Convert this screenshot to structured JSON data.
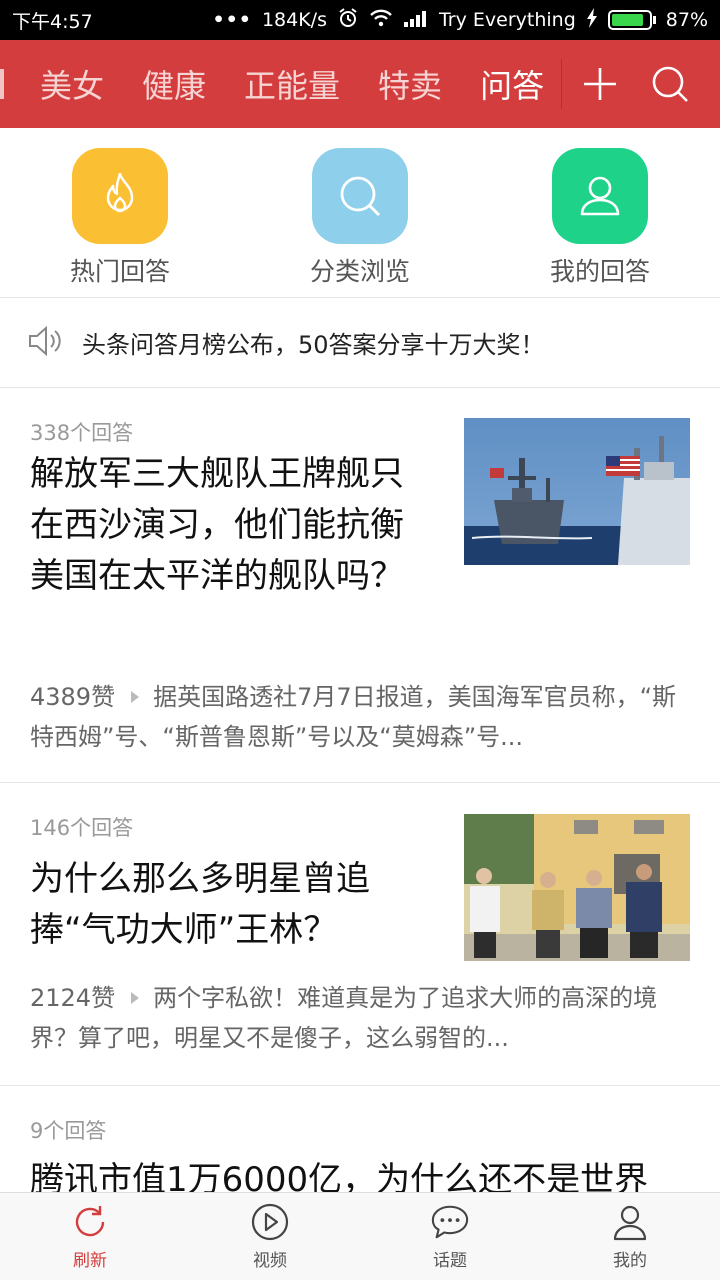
{
  "status_bar": {
    "time": "下午4:57",
    "dots": "•••",
    "speed": "184K/s",
    "carrier": "Try Everything",
    "battery": "87%",
    "battery_level": 0.87
  },
  "channels": [
    "美女",
    "健康",
    "正能量",
    "特卖",
    "问答"
  ],
  "active_channel": 4,
  "categories": [
    {
      "label": "热门回答",
      "color": "#fbbf33",
      "icon": "fire-icon"
    },
    {
      "label": "分类浏览",
      "color": "#8ed0ec",
      "icon": "search-icon"
    },
    {
      "label": "我的回答",
      "color": "#1fd28a",
      "icon": "user-icon"
    }
  ],
  "notice": "头条问答月榜公布，50答案分享十万大奖！",
  "feed": [
    {
      "count": "338个回答",
      "title": "解放军三大舰队王牌舰只在西沙演习，他们能抗衡美国在太平洋的舰队吗？",
      "likes": "4389赞",
      "excerpt": "据英国路透社7月7日报道，美国海军官员称，“斯特西姆”号、“斯普鲁恩斯”号以及“莫姆森”号..."
    },
    {
      "count": "146个回答",
      "title": "为什么那么多明星曾追捧“气功大师”王林？",
      "likes": "2124赞",
      "excerpt": "两个字私欲！难道真是为了追求大师的高深的境界？算了吧，明星又不是傻子，这么弱智的..."
    },
    {
      "count": "9个回答",
      "title": "腾讯市值1万6000亿，为什么还不是世界"
    }
  ],
  "tabs": [
    {
      "label": "刷新",
      "icon": "refresh-icon"
    },
    {
      "label": "视频",
      "icon": "play-icon"
    },
    {
      "label": "话题",
      "icon": "chat-icon"
    },
    {
      "label": "我的",
      "icon": "user-icon"
    }
  ],
  "colors": {
    "brand": "#d43d3d"
  }
}
